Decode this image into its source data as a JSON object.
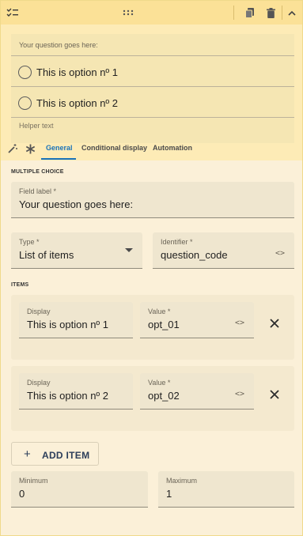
{
  "toolbar": {
    "left_icon": "checklist-icon",
    "drag_icon": "drag-handle-icon",
    "copy_icon": "copy-icon",
    "delete_icon": "trash-icon",
    "collapse_icon": "chevron-up-icon"
  },
  "preview": {
    "question": "Your question goes here:",
    "options": [
      "This is option nº 1",
      "This is option nº 2"
    ],
    "helper_text": "Helper text"
  },
  "tabs": {
    "icons": [
      "magic-wand-icon",
      "asterisk-icon"
    ],
    "items": [
      {
        "label": "General",
        "active": true
      },
      {
        "label": "Conditional display",
        "active": false
      },
      {
        "label": "Automation",
        "active": false
      }
    ]
  },
  "config": {
    "section_title": "MULTIPLE CHOICE",
    "field_label": {
      "label": "Field label *",
      "value": "Your question goes here:"
    },
    "type": {
      "label": "Type *",
      "value": "List of items"
    },
    "identifier": {
      "label": "Identifier *",
      "value": "question_code"
    },
    "items_title": "ITEMS",
    "items": [
      {
        "display_label": "Display",
        "display": "This is option nº 1",
        "value_label": "Value *",
        "value": "opt_01"
      },
      {
        "display_label": "Display",
        "display": "This is option nº 2",
        "value_label": "Value *",
        "value": "opt_02"
      }
    ],
    "add_item": {
      "icon": "+",
      "label": "ADD ITEM"
    },
    "minimum": {
      "label": "Minimum",
      "value": "0"
    },
    "maximum": {
      "label": "Maximum",
      "value": "1"
    },
    "code_icon": "<>"
  },
  "colors": {
    "toolbar_bg": "#fbe197",
    "preview_bg": "#fdebb6",
    "config_bg": "#fbf0d8",
    "accent": "#1a73b8"
  }
}
